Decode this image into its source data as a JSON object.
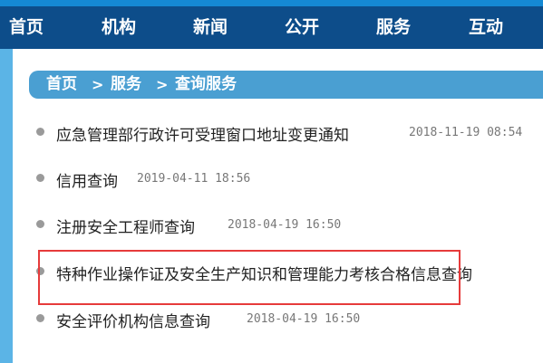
{
  "nav": {
    "items": [
      "首页",
      "机构",
      "新闻",
      "公开",
      "服务",
      "互动"
    ]
  },
  "breadcrumb": {
    "home": "首页",
    "sep": ">",
    "service": "服务",
    "current": "查询服务"
  },
  "list": {
    "items": [
      {
        "title": "应急管理部行政许可受理窗口地址变更通知",
        "date": "2018-11-19 08:54"
      },
      {
        "title": "信用查询",
        "date": "2019-04-11 18:56"
      },
      {
        "title": "注册安全工程师查询",
        "date": "2018-04-19 16:50"
      },
      {
        "title": "特种作业操作证及安全生产知识和管理能力考核合格信息查询",
        "date": ""
      },
      {
        "title": "安全评价机构信息查询",
        "date": "2018-04-19 16:50"
      }
    ]
  },
  "colors": {
    "nav_bg": "#0d4d8a",
    "crumb_bg": "#4a9fd2",
    "highlight": "#e63b3b",
    "side_bg": "#5bb4e6"
  }
}
